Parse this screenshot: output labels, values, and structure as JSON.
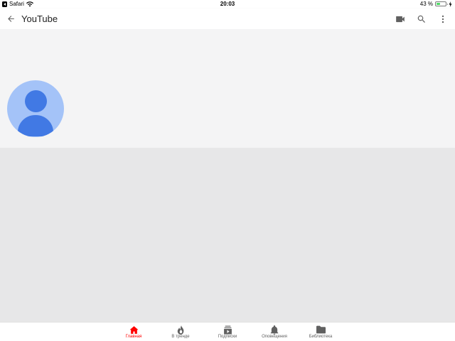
{
  "status_bar": {
    "back_app": "Safari",
    "time": "20:03",
    "battery_percent_label": "43 %",
    "battery_level": 0.43,
    "icons": [
      "back-app-icon",
      "wifi-icon",
      "battery-icon",
      "charging-icon"
    ]
  },
  "app_bar": {
    "title": "YouTube",
    "icons": [
      "back-arrow-icon",
      "video-camera-icon",
      "search-icon",
      "more-vert-icon"
    ]
  },
  "channel": {
    "avatar_icon": "default-avatar-icon"
  },
  "bottom_nav": {
    "items": [
      {
        "label": "Главная",
        "icon": "home-icon",
        "active": true
      },
      {
        "label": "В тренде",
        "icon": "flame-icon",
        "active": false
      },
      {
        "label": "Подписки",
        "icon": "subscriptions-icon",
        "active": false
      },
      {
        "label": "Оповещения",
        "icon": "bell-icon",
        "active": false
      },
      {
        "label": "Библиотека",
        "icon": "folder-icon",
        "active": false
      }
    ]
  },
  "colors": {
    "accent": "#ff0000",
    "icon_gray": "#606060",
    "avatar_bg": "#a4c3f8",
    "avatar_fg": "#4179e4",
    "header_bg": "#f4f4f5",
    "content_bg": "#e7e7e8",
    "battery_fill": "#4cd964"
  }
}
